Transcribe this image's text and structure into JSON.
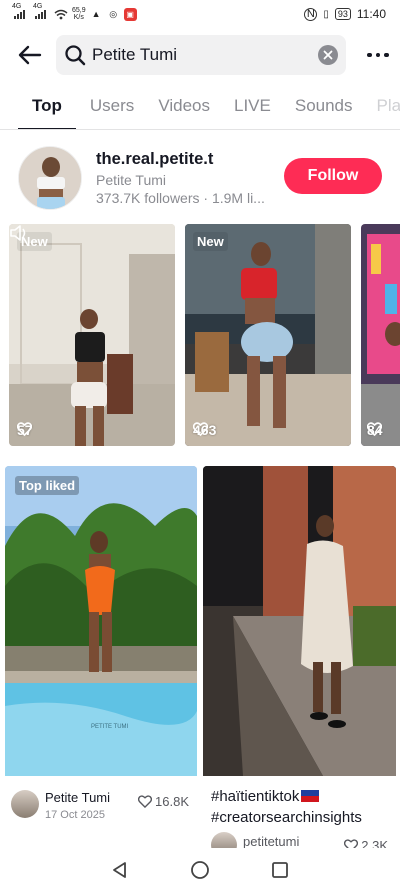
{
  "status_bar": {
    "signal_1": "4G",
    "signal_2": "4G",
    "net_speed_value": "65,9",
    "net_speed_unit": "K/s",
    "battery": "93",
    "time": "11:40"
  },
  "search": {
    "query": "Petite Tumi"
  },
  "tabs": [
    "Top",
    "Users",
    "Videos",
    "LIVE",
    "Sounds",
    "Pla"
  ],
  "user": {
    "username": "the.real.petite.t",
    "display_name": "Petite Tumi",
    "stats": "373.7K followers · 1.9M li...",
    "follow_label": "Follow"
  },
  "videos": [
    {
      "badge": "New",
      "likes": "57"
    },
    {
      "badge": "New",
      "likes": "463"
    },
    {
      "badge": "",
      "likes": "84"
    }
  ],
  "grid": [
    {
      "badge": "Top liked",
      "watermark": "PETITE TUMI",
      "author": "Petite Tumi",
      "date": "17 Oct 2025",
      "likes": "16.8K"
    },
    {
      "caption_line1": "#haïtientiktok",
      "caption_line2": "#creatorsearchinsights",
      "author": "petitetumi",
      "likes": "2.3K"
    }
  ],
  "colors": {
    "accent": "#fe2c55",
    "text": "#161823",
    "muted": "#8a8b91"
  }
}
